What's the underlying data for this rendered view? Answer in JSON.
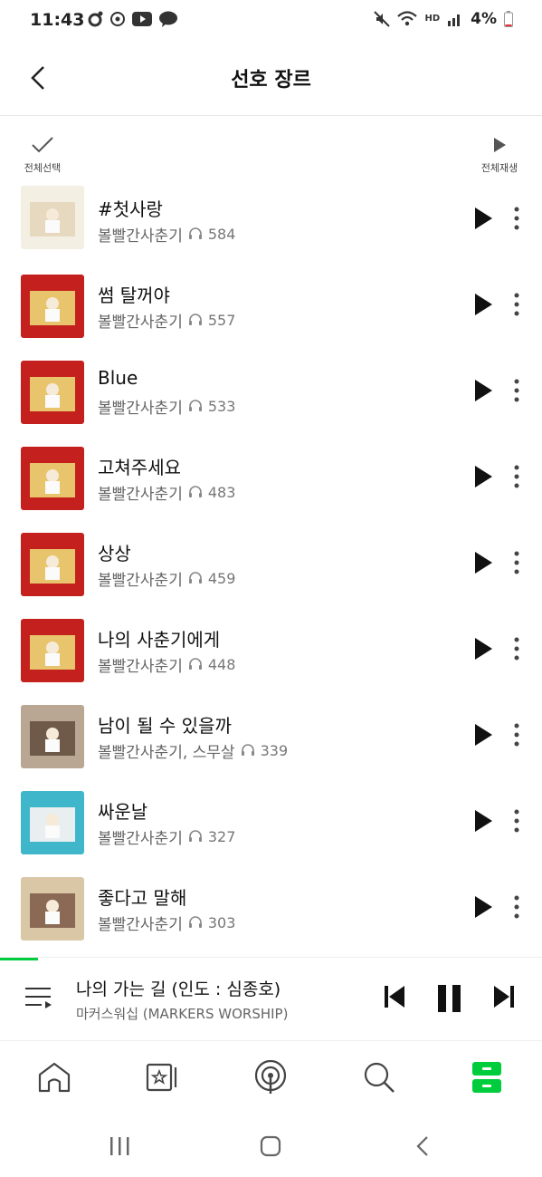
{
  "status_bar": {
    "time": "11:43",
    "battery": "4%",
    "network_label": "HD"
  },
  "header": {
    "title": "선호 장르"
  },
  "actions": {
    "select_all": "전체선택",
    "play_all": "전체재생"
  },
  "songs": [
    {
      "title": "#첫사랑",
      "artist": "볼빨간사춘기",
      "plays": "584",
      "thumb_colors": [
        "#f4efe3",
        "#e7d9bf"
      ]
    },
    {
      "title": "썸 탈꺼야",
      "artist": "볼빨간사춘기",
      "plays": "557",
      "thumb_colors": [
        "#c4201d",
        "#e8c56c"
      ]
    },
    {
      "title": "Blue",
      "artist": "볼빨간사춘기",
      "plays": "533",
      "thumb_colors": [
        "#c4201d",
        "#e8c56c"
      ]
    },
    {
      "title": "고쳐주세요",
      "artist": "볼빨간사춘기",
      "plays": "483",
      "thumb_colors": [
        "#c4201d",
        "#e8c56c"
      ]
    },
    {
      "title": "상상",
      "artist": "볼빨간사춘기",
      "plays": "459",
      "thumb_colors": [
        "#c4201d",
        "#e8c56c"
      ]
    },
    {
      "title": "나의 사춘기에게",
      "artist": "볼빨간사춘기",
      "plays": "448",
      "thumb_colors": [
        "#c4201d",
        "#e8c56c"
      ]
    },
    {
      "title": "남이 될 수 있을까",
      "artist": "볼빨간사춘기, 스무살",
      "plays": "339",
      "thumb_colors": [
        "#b9a793",
        "#6f5a4a"
      ]
    },
    {
      "title": "싸운날",
      "artist": "볼빨간사춘기",
      "plays": "327",
      "thumb_colors": [
        "#3fb6c9",
        "#e9eef0"
      ]
    },
    {
      "title": "좋다고 말해",
      "artist": "볼빨간사춘기",
      "plays": "303",
      "thumb_colors": [
        "#d9c7a6",
        "#8a6a55"
      ]
    }
  ],
  "now_playing": {
    "title": "나의 가는 길 (인도 : 심종호)",
    "artist": "마커스워십 (MARKERS WORSHIP)",
    "progress": 0.07
  },
  "colors": {
    "accent": "#00cd3c"
  },
  "icons": {
    "play": "play-icon",
    "more": "more-vertical-icon",
    "headphones": "headphones-icon"
  }
}
